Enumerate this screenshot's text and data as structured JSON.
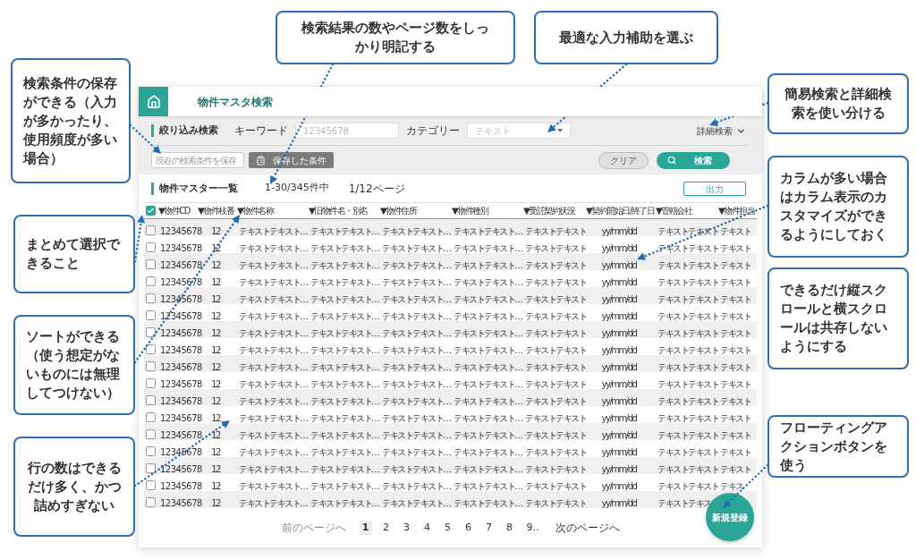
{
  "callouts": [
    {
      "text": "検索条件の保存ができる（入力が多かったり、使用頻度が多い場合）"
    },
    {
      "text": "まとめて選択できること"
    },
    {
      "text": "ソートができる（使う想定がないものには無理してつけない）"
    },
    {
      "text": "行の数はできるだけ多く、かつ詰めすぎない"
    },
    {
      "text": "検索結果の数やページ数をしっかり明記する"
    },
    {
      "text": "最適な入力補助を選ぶ"
    },
    {
      "text": "簡易検索と詳細検索を使い分ける"
    },
    {
      "text": "カラムが多い場合はカラム表示のカスタマイズができるようにしておく"
    },
    {
      "text": "できるだけ縦スクロールと横スクロールは共存しないようにする"
    },
    {
      "text": "フローティングアクションボタンを使う"
    }
  ],
  "app": {
    "title": "物件マスタ検索"
  },
  "filter": {
    "title": "絞り込み検索",
    "keyword": {
      "label": "キーワード",
      "placeholder": "12345678"
    },
    "category": {
      "label": "カテゴリー",
      "placeholder": "テキスト"
    },
    "advanced_toggle": "詳細検索",
    "save_field": {
      "placeholder": "現在の検索条件を保存"
    },
    "saved_button": "保存した条件",
    "clear_button": "クリア",
    "search_button": "検索"
  },
  "list": {
    "title": "物件マスター一覧",
    "count": "1-30/345件中",
    "pages": "1/12ページ",
    "export_button": "出力",
    "select_all": {
      "checked": true
    },
    "columns": [
      "▼物件CD",
      "▼物件枝番",
      "▼物件名称",
      "▼旧物件名・別名",
      "▼物件住所",
      "▼物件種別",
      "▼受託契約状況",
      "▼契約開始日/終了日",
      "▼管轄会社",
      "▼物件担当"
    ],
    "rows": [
      {
        "checked": false,
        "cells": [
          "12345678",
          "12",
          "テキストテキスト…",
          "テキストテキスト…",
          "テキストテキスト…",
          "テキストテキスト…",
          "テキストテキスト",
          "yy/mm/dd",
          "テキストテキスト",
          "テキスト"
        ]
      },
      {
        "checked": false,
        "cells": [
          "12345678",
          "12",
          "テキストテキスト…",
          "テキストテキスト…",
          "テキストテキスト…",
          "テキストテキスト…",
          "テキストテキスト",
          "yy/mm/dd",
          "テキストテキスト",
          "テキスト"
        ]
      },
      {
        "checked": false,
        "cells": [
          "12345678",
          "12",
          "テキストテキスト…",
          "テキストテキスト…",
          "テキストテキスト…",
          "テキストテキスト…",
          "テキストテキスト",
          "yy/mm/dd",
          "テキストテキスト",
          "テキスト"
        ]
      },
      {
        "checked": false,
        "cells": [
          "12345678",
          "12",
          "テキストテキスト…",
          "テキストテキスト…",
          "テキストテキスト…",
          "テキストテキスト…",
          "テキストテキスト",
          "yy/mm/dd",
          "テキストテキスト",
          "テキスト"
        ]
      },
      {
        "checked": false,
        "cells": [
          "12345678",
          "12",
          "テキストテキスト…",
          "テキストテキスト…",
          "テキストテキスト…",
          "テキストテキスト…",
          "テキストテキスト",
          "yy/mm/dd",
          "テキストテキスト",
          "テキスト"
        ]
      },
      {
        "checked": false,
        "cells": [
          "12345678",
          "12",
          "テキストテキスト…",
          "テキストテキスト…",
          "テキストテキスト…",
          "テキストテキスト…",
          "テキストテキスト",
          "yy/mm/dd",
          "テキストテキスト",
          "テキスト"
        ]
      },
      {
        "checked": false,
        "cells": [
          "12345678",
          "12",
          "テキストテキスト…",
          "テキストテキスト…",
          "テキストテキスト…",
          "テキストテキスト…",
          "テキストテキスト",
          "yy/mm/dd",
          "テキストテキスト",
          "テキスト"
        ]
      },
      {
        "checked": false,
        "cells": [
          "12345678",
          "12",
          "テキストテキスト…",
          "テキストテキスト…",
          "テキストテキスト…",
          "テキストテキスト…",
          "テキストテキスト",
          "yy/mm/dd",
          "テキストテキスト",
          "テキスト"
        ]
      },
      {
        "checked": false,
        "cells": [
          "12345678",
          "12",
          "テキストテキスト…",
          "テキストテキスト…",
          "テキストテキスト…",
          "テキストテキスト…",
          "テキストテキスト",
          "yy/mm/dd",
          "テキストテキスト",
          "テキスト"
        ]
      },
      {
        "checked": false,
        "cells": [
          "12345678",
          "12",
          "テキストテキスト…",
          "テキストテキスト…",
          "テキストテキスト…",
          "テキストテキスト…",
          "テキストテキスト",
          "yy/mm/dd",
          "テキストテキスト",
          "テキスト"
        ]
      },
      {
        "checked": false,
        "cells": [
          "12345678",
          "12",
          "テキストテキスト…",
          "テキストテキスト…",
          "テキストテキスト…",
          "テキストテキスト…",
          "テキストテキスト",
          "yy/mm/dd",
          "テキストテキスト",
          "テキスト"
        ]
      },
      {
        "checked": false,
        "cells": [
          "12345678",
          "12",
          "テキストテキスト…",
          "テキストテキスト…",
          "テキストテキスト…",
          "テキストテキスト…",
          "テキストテキスト",
          "yy/mm/dd",
          "テキストテキスト",
          "テキスト"
        ]
      },
      {
        "checked": false,
        "cells": [
          "12345678",
          "12",
          "テキストテキスト…",
          "テキストテキスト…",
          "テキストテキスト…",
          "テキストテキスト…",
          "テキストテキスト",
          "yy/mm/dd",
          "テキストテキスト",
          "テキスト"
        ]
      },
      {
        "checked": false,
        "cells": [
          "12345678",
          "12",
          "テキストテキスト…",
          "テキストテキスト…",
          "テキストテキスト…",
          "テキストテキスト…",
          "テキストテキスト",
          "yy/mm/dd",
          "テキストテキスト",
          "テキスト"
        ]
      },
      {
        "checked": false,
        "cells": [
          "12345678",
          "12",
          "テキストテキスト…",
          "テキストテキスト…",
          "テキストテキスト…",
          "テキストテキスト…",
          "テキストテキスト",
          "yy/mm/dd",
          "テキストテキスト",
          "テキスト"
        ]
      },
      {
        "checked": false,
        "cells": [
          "12345678",
          "12",
          "テキストテキスト…",
          "テキストテキスト…",
          "テキストテキスト…",
          "テキストテキスト…",
          "テキストテキスト",
          "yy/mm/dd",
          "テキストテキスト",
          "テキス"
        ]
      },
      {
        "checked": false,
        "cells": [
          "12345678",
          "12",
          "テキストテキスト…",
          "テキストテキスト…",
          "テキストテキスト…",
          "テキストテキスト…",
          "テキストテキスト",
          "yy/mm/dd",
          "テキストテキス"
        ]
      }
    ]
  },
  "pagination": {
    "prev": "前のページへ",
    "pages": [
      {
        "label": "1",
        "selected": true
      },
      {
        "label": "2",
        "selected": false
      },
      {
        "label": "3",
        "selected": false
      },
      {
        "label": "4",
        "selected": false
      },
      {
        "label": "5",
        "selected": false
      },
      {
        "label": "6",
        "selected": false
      },
      {
        "label": "7",
        "selected": false
      },
      {
        "label": "8",
        "selected": false
      },
      {
        "label": "9..",
        "selected": false
      }
    ],
    "next": "次のページへ"
  },
  "fab": {
    "label": "新規登録"
  }
}
